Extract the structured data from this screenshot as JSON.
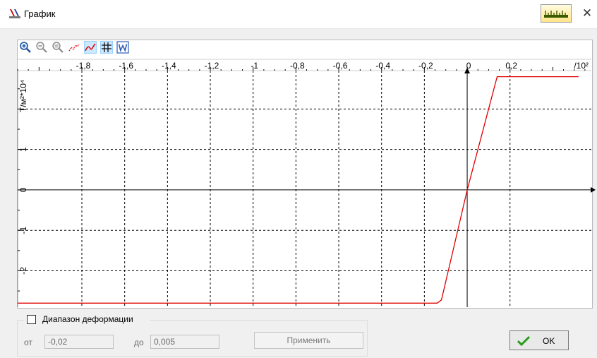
{
  "window": {
    "title": "График"
  },
  "toolbar": {
    "buttons": [
      "zoom-in-icon",
      "zoom-out-icon",
      "zoom-reset-icon",
      "points-icon",
      "line-icon",
      "grid-icon",
      "word-icon"
    ],
    "active": [
      "line-icon",
      "grid-icon"
    ]
  },
  "plot": {
    "x_ticks": [
      "-1,8",
      "-1,6",
      "-1,4",
      "-1,2",
      "-1",
      "-0,8",
      "-0,6",
      "-0,4",
      "-0,2",
      "0",
      "0,2"
    ],
    "x_scale": "/10²",
    "y_label": "Т/м²*10⁴",
    "y_ticks": [
      "1",
      "0",
      "-1",
      "-2"
    ],
    "colors": {
      "curve": "#e00000",
      "axis": "#000000",
      "grid": "#000000"
    }
  },
  "chart_data": {
    "type": "line",
    "x_multiplier": "10^2",
    "y_multiplier": "10^4",
    "series": [
      {
        "x": [
          -2.1,
          -0.14,
          -0.12,
          0.0,
          0.14,
          0.52
        ],
        "y": [
          -2.8,
          -2.8,
          -2.72,
          0.0,
          2.8,
          2.8
        ]
      }
    ],
    "xlim": [
      -2.1,
      0.58
    ],
    "ylim": [
      -2.9,
      2.95
    ],
    "grid": true
  },
  "range": {
    "checkbox_label": "Диапазон деформации",
    "checked": false,
    "from_label": "от",
    "from_value": "-0,02",
    "to_label": "до",
    "to_value": "0,005",
    "apply_label": "Применить"
  },
  "ok_label": "OK"
}
